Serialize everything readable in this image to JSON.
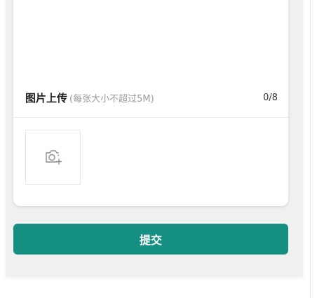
{
  "upload": {
    "title": "图片上传",
    "hint": "(每张大小不超过5M)",
    "count": "0/8",
    "add_icon": "camera-plus-icon"
  },
  "actions": {
    "submit_label": "提交"
  },
  "colors": {
    "accent": "#148f82",
    "page_bg": "#f0f0f0",
    "hint_text": "#9a9a9a"
  }
}
